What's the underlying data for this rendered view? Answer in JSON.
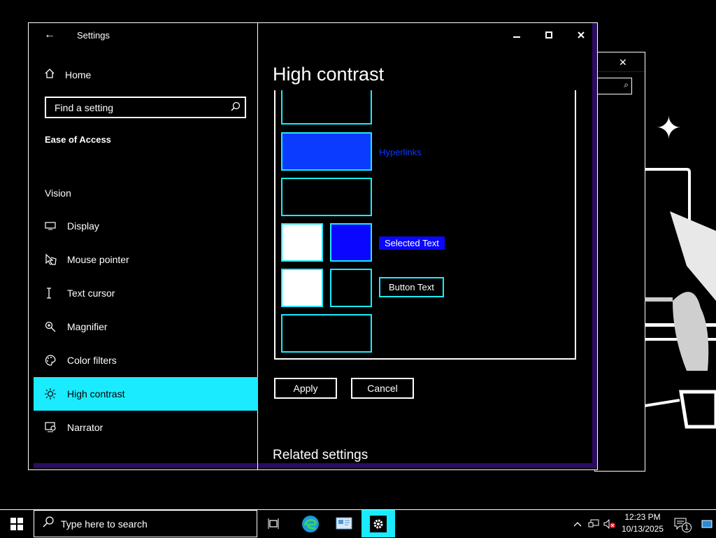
{
  "window": {
    "app_title": "Settings",
    "page_title": "High contrast",
    "controls": {
      "minimize": "—",
      "maximize": "□",
      "close": "✕"
    }
  },
  "sidebar": {
    "home": "Home",
    "search_placeholder": "Find a setting",
    "section": "Ease of Access",
    "group": "Vision",
    "items": [
      {
        "label": "Display",
        "icon": "monitor-icon"
      },
      {
        "label": "Mouse pointer",
        "icon": "mouse-pointer-icon"
      },
      {
        "label": "Text cursor",
        "icon": "text-cursor-icon"
      },
      {
        "label": "Magnifier",
        "icon": "magnifier-icon"
      },
      {
        "label": "Color filters",
        "icon": "color-filters-icon"
      },
      {
        "label": "High contrast",
        "icon": "high-contrast-icon",
        "active": true
      },
      {
        "label": "Narrator",
        "icon": "narrator-icon"
      }
    ]
  },
  "theme_colors": {
    "hyperlinks_label": "Hyperlinks",
    "hyperlinks_color": "#0a3bff",
    "selected_text_label": "Selected Text",
    "selected_text_bg": "#0a06ff",
    "selected_text_fg": "#ffffff",
    "button_text_label": "Button Text",
    "button_bg": "#000000",
    "button_fg": "#ffffff",
    "accent": "#1aebff"
  },
  "actions": {
    "apply": "Apply",
    "cancel": "Cancel"
  },
  "related": "Related settings",
  "taskbar": {
    "search_placeholder": "Type here to search",
    "time": "12:23 PM",
    "date": "10/13/2025",
    "notification_count": "1"
  }
}
